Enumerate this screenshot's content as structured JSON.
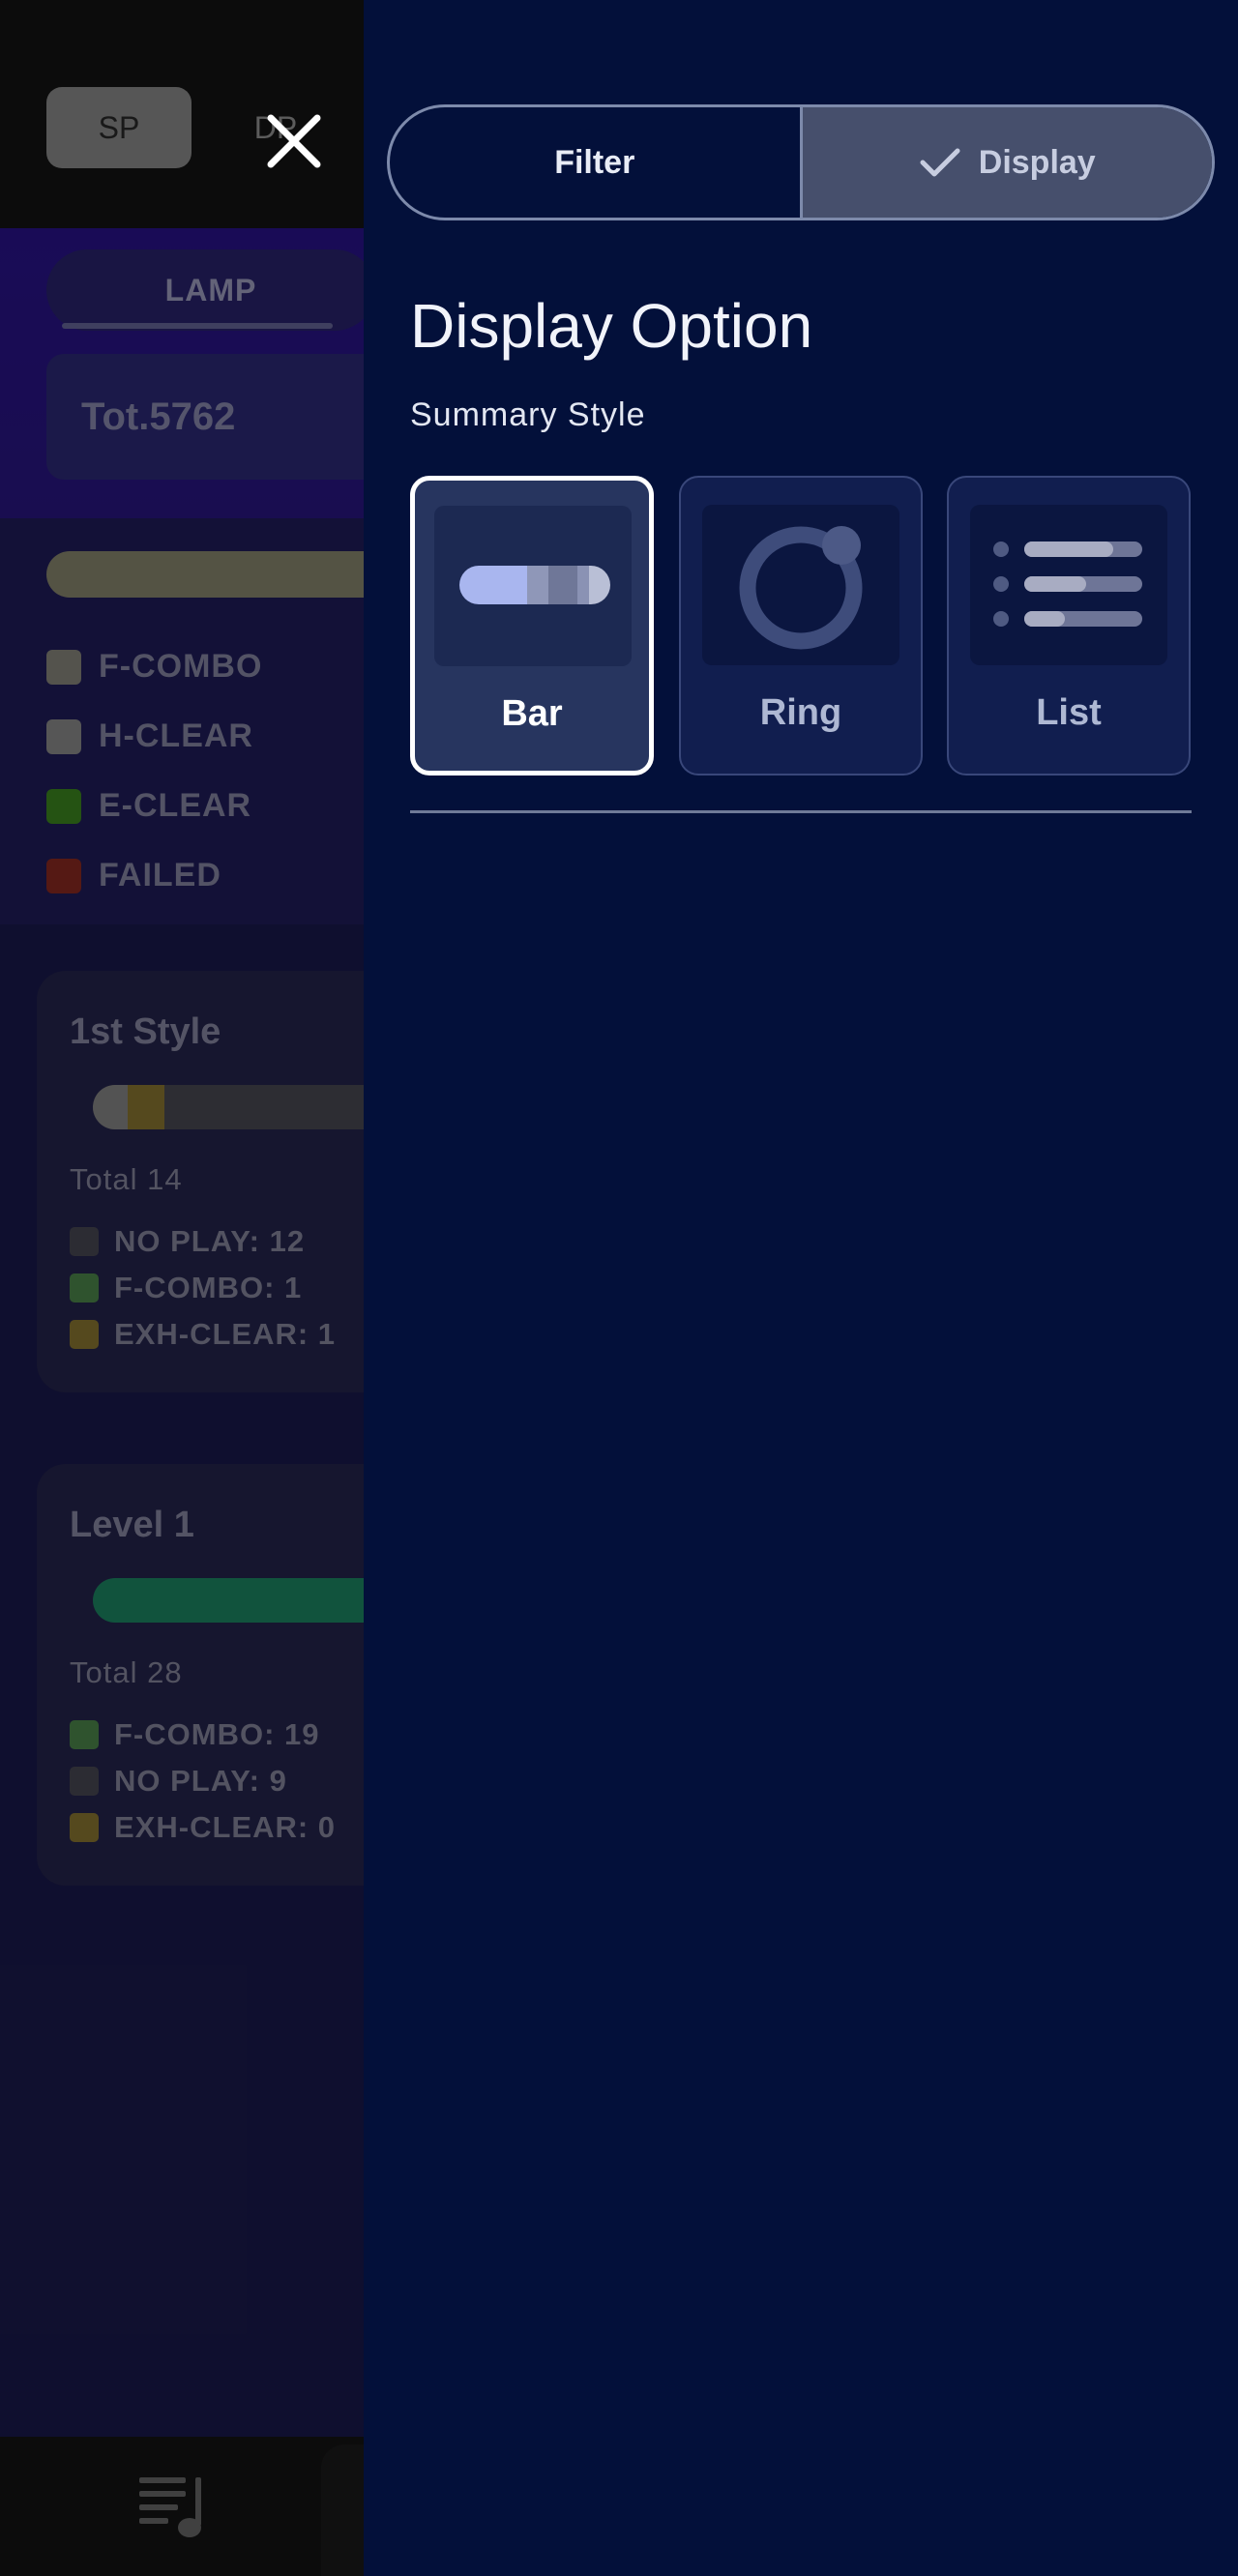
{
  "background": {
    "mode_tabs": [
      "SP",
      "DP"
    ],
    "lamp_tab": "LAMP",
    "total": "Tot.5762",
    "lamp_legend": [
      {
        "label": "F-COMBO",
        "color": "#8c8a80"
      },
      {
        "label": "H-CLEAR",
        "color": "#8f8f8f"
      },
      {
        "label": "E-CLEAR",
        "color": "#3f8a20"
      },
      {
        "label": "FAILED",
        "color": "#8e2a22"
      }
    ],
    "cards": [
      {
        "title": "1st Style",
        "total": "Total 14",
        "legend": [
          {
            "label": "NO PLAY: 12",
            "color": "#4a4a55"
          },
          {
            "label": "F-COMBO: 1",
            "color": "#4f8a4e"
          },
          {
            "label": "EXH-CLEAR: 1",
            "color": "#8e7a33"
          }
        ]
      },
      {
        "title": "Level 1",
        "total": "Total 28",
        "legend": [
          {
            "label": "F-COMBO: 19",
            "color": "#4f8a4e"
          },
          {
            "label": "NO PLAY: 9",
            "color": "#4a4a55"
          },
          {
            "label": "EXH-CLEAR: 0",
            "color": "#8e7a33"
          }
        ]
      }
    ]
  },
  "drawer": {
    "tabs": [
      {
        "label": "Filter",
        "active": false
      },
      {
        "label": "Display",
        "active": true,
        "icon": "check-icon"
      }
    ],
    "title": "Display Option",
    "subtitle": "Summary Style",
    "styles": [
      {
        "label": "Bar",
        "selected": true,
        "icon": "bar-style-icon"
      },
      {
        "label": "Ring",
        "selected": false,
        "icon": "ring-style-icon"
      },
      {
        "label": "List",
        "selected": false,
        "icon": "list-style-icon"
      }
    ]
  },
  "colors": {
    "drawer_bg": "#03103a",
    "accent_white": "#ffffff",
    "thumb_highlight": "#a9b6ef"
  }
}
